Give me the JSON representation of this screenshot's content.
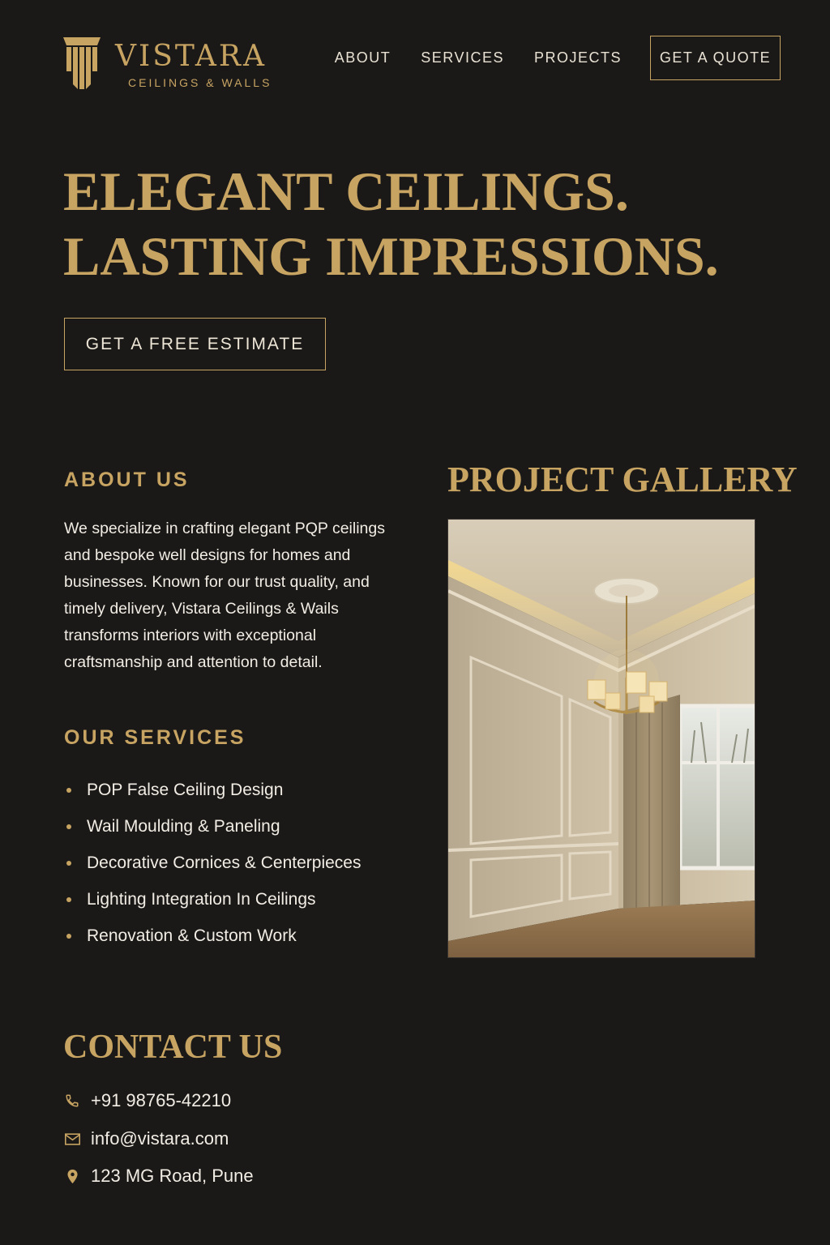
{
  "brand": {
    "name": "VISTARA",
    "tagline": "CEILINGS & WALLS",
    "gold": "#c8a462",
    "background": "#1a1918"
  },
  "nav": {
    "items": [
      "ABOUT",
      "SERVICES",
      "PROJECTS"
    ],
    "cta": "GET A QUOTE"
  },
  "hero": {
    "line1": "ELEGANT CEILINGS.",
    "line2": "LASTING IMPRESSIONS.",
    "cta": "GET A FREE ESTIMATE"
  },
  "about": {
    "heading": "ABOUT US",
    "text": "We specialize in crafting elegant PQP ceilings and bespoke well designs for homes and businesses. Known for our trust quality, and timely delivery, Vistara Ceilings & Wails transforms interiors with exceptional craftsmanship and attention to detail."
  },
  "services": {
    "heading": "OUR SERVICES",
    "items": [
      "POP False Ceiling Design",
      "Wail Moulding & Paneling",
      "Decorative Cornices & Centerpieces",
      "Lighting Integration In Ceilings",
      "Renovation & Custom Work"
    ]
  },
  "gallery": {
    "heading": "PROJECT GALLERY"
  },
  "contact": {
    "heading": "CONTACT US",
    "phone": "+91 98765-42210",
    "email": "info@vistara.com",
    "address": "123 MG Road, Pune",
    "icons": [
      "phone-icon",
      "mail-icon",
      "location-pin-icon"
    ]
  }
}
